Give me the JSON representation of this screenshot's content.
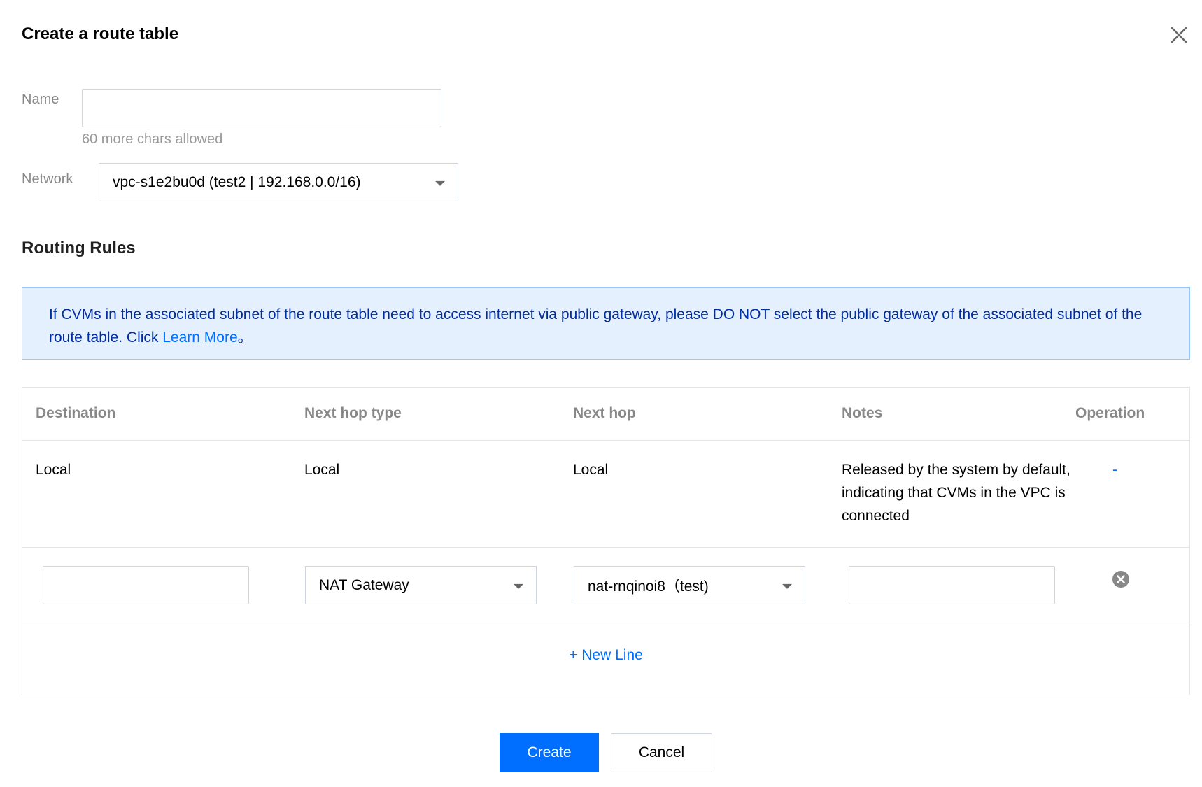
{
  "dialog": {
    "title": "Create a route table",
    "close_icon": "close-icon"
  },
  "form": {
    "name_label": "Name",
    "name_value": "",
    "name_hint": "60 more chars allowed",
    "network_label": "Network",
    "network_value": "vpc-s1e2bu0d (test2 | 192.168.0.0/16)"
  },
  "routing": {
    "section_title": "Routing Rules",
    "notice_text": "If CVMs in the associated subnet of the route table need to access internet via public gateway, please DO NOT select the public gateway of the associated subnet of the route table. Click ",
    "notice_link": "Learn More",
    "notice_suffix": "。"
  },
  "table": {
    "headers": {
      "destination": "Destination",
      "next_hop_type": "Next hop type",
      "next_hop": "Next hop",
      "notes": "Notes",
      "operation": "Operation"
    },
    "default_row": {
      "destination": "Local",
      "next_hop_type": "Local",
      "next_hop": "Local",
      "notes": "Released by the system by default, indicating that CVMs in the VPC is connected",
      "operation": "-"
    },
    "edit_row": {
      "destination_value": "",
      "next_hop_type_value": "NAT Gateway",
      "next_hop_value": "nat-rnqinoi8（test)",
      "notes_value": "",
      "remove_icon": "remove-circle-icon"
    },
    "new_line_label": "+ New Line"
  },
  "footer": {
    "create_label": "Create",
    "cancel_label": "Cancel"
  },
  "colors": {
    "accent": "#006eff",
    "notice_bg": "#e5f0ff",
    "notice_border": "#97c7ff",
    "border": "#cfd5de"
  }
}
